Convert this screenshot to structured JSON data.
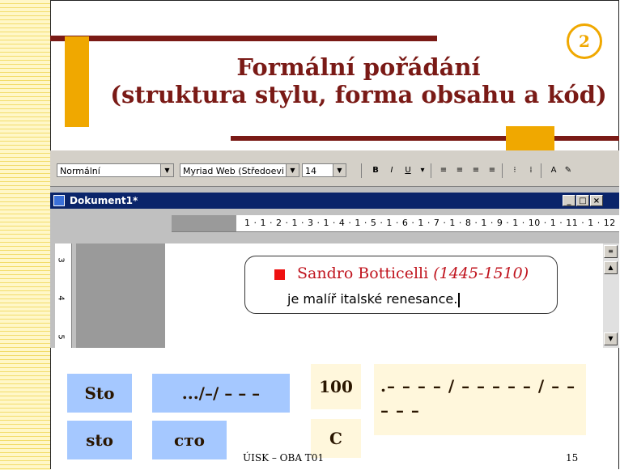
{
  "slide": {
    "badge": "2",
    "title_line1": "Formální pořádání",
    "title_line2": "(struktura stylu, forma obsahu a kód)",
    "footer": "ÚISK – OBA T01",
    "page_number": "15"
  },
  "word": {
    "toolbar": {
      "style": "Normální",
      "font": "Myriad Web (Středoevi",
      "size": "14"
    },
    "window_title": "Dokument1*",
    "ruler": "1 · 1 · 2 · 1 · 3 · 1 · 4 · 1 · 5 · 1 · 6 · 1 · 7 · 1 · 8 · 1 · 9 · 1 · 10 · 1 · 11 · 1 · 12",
    "vruler": [
      "3",
      "4",
      "5"
    ],
    "painter_name": "Sandro Botticelli",
    "painter_dates": "(1445-1510)",
    "painter_desc": "je malíř italské renesance."
  },
  "grid": {
    "sto_cap": "Sto",
    "morse_sym": ".../–/ – – –",
    "num100": "100",
    "morse_long": ".– – – – / – – – – – / – – – – –",
    "sto_low": "sto",
    "cyrillic": "сто",
    "roman": "C"
  }
}
